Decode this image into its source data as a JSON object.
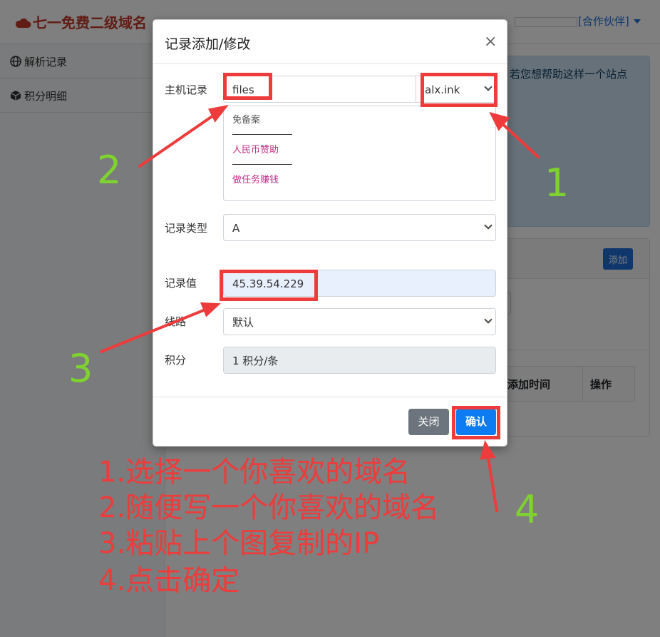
{
  "navbar": {
    "brand": "七一免费二级域名",
    "partner_link": "[合作伙伴]"
  },
  "sidebar": {
    "items": [
      {
        "label": "解析记录",
        "icon": "globe-icon"
      },
      {
        "label": "积分明细",
        "icon": "cube-icon"
      }
    ]
  },
  "main": {
    "alert_text": "若您想帮助这样一个站点",
    "add_button": "添加",
    "table_headers": [
      "添加时间",
      "操作"
    ]
  },
  "modal": {
    "title": "记录添加/修改",
    "close_symbol": "×",
    "fields": {
      "host": {
        "label": "主机记录",
        "value": "files",
        "domain": "alx.ink"
      },
      "domain_panel": {
        "heading": "免备案",
        "links": [
          "人民币赞助",
          "做任务赚钱"
        ]
      },
      "type": {
        "label": "记录类型",
        "value": "A"
      },
      "value": {
        "label": "记录值",
        "value": "45.39.54.229"
      },
      "line": {
        "label": "线路",
        "value": "默认"
      },
      "points": {
        "label": "积分",
        "value": "1 积分/条"
      }
    },
    "buttons": {
      "close": "关闭",
      "confirm": "确认"
    }
  },
  "annotations": {
    "numbers": [
      "1",
      "2",
      "3",
      "4"
    ],
    "steps": [
      "1.选择一个你喜欢的域名",
      "2.随便写一个你喜欢的域名",
      "3.粘贴上个图复制的IP",
      "4.点击确定"
    ],
    "colors": {
      "highlight": "#ee3b3b",
      "number": "#7fd32e"
    }
  }
}
